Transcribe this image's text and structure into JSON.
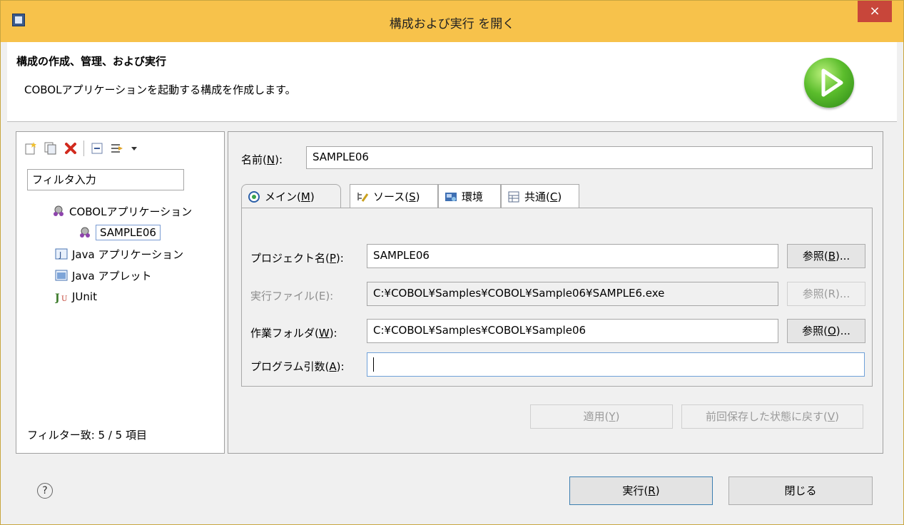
{
  "window": {
    "title": "構成および実行 を開く",
    "close_glyph": "×"
  },
  "header": {
    "title": "構成の作成、管理、および実行",
    "description": "COBOLアプリケーションを起動する構成を作成します。"
  },
  "left": {
    "filter_placeholder": "フィルタ入力",
    "tree": [
      {
        "label": "COBOLアプリケーション",
        "icon": "cobol-app-icon"
      },
      {
        "label": "SAMPLE06",
        "icon": "cobol-config-icon"
      },
      {
        "label": "Java アプリケーション",
        "icon": "java-app-icon"
      },
      {
        "label": "Java アプレット",
        "icon": "java-applet-icon"
      },
      {
        "label": "JUnit",
        "icon": "junit-icon"
      }
    ],
    "filter_count": "フィルター致: 5 / 5 項目"
  },
  "right": {
    "name_label": "名前(",
    "name_key": "N",
    "name_label_end": "):",
    "name_value": "SAMPLE06",
    "tabs": [
      {
        "label": "メイン(",
        "key": "M",
        "end": ")"
      },
      {
        "label": "ソース(",
        "key": "S",
        "end": ")"
      },
      {
        "label": "環境",
        "key": "",
        "end": ""
      },
      {
        "label": "共通(",
        "key": "C",
        "end": ")"
      }
    ],
    "rows": {
      "project": {
        "label": "プロジェクト名(",
        "key": "P",
        "end": "):",
        "value": "SAMPLE06",
        "browse": "参照(",
        "browse_key": "B",
        "browse_end": ")..."
      },
      "exe": {
        "label": "実行ファイル(E):",
        "value": "C:¥COBOL¥Samples¥COBOL¥Sample06¥SAMPLE6.exe",
        "browse": "参照(R)..."
      },
      "workdir": {
        "label": "作業フォルダ(",
        "key": "W",
        "end": "):",
        "value": "C:¥COBOL¥Samples¥COBOL¥Sample06",
        "browse": "参照(",
        "browse_key": "O",
        "browse_end": ")..."
      },
      "args": {
        "label": "プログラム引数(",
        "key": "A",
        "end": "):",
        "value": ""
      }
    },
    "apply": {
      "label": "適用(",
      "key": "Y",
      "end": ")"
    },
    "revert": {
      "label": "前回保存した状態に戻す(",
      "key": "V",
      "end": ")"
    }
  },
  "footer": {
    "help_glyph": "?",
    "run": {
      "label": "実行(",
      "key": "R",
      "end": ")"
    },
    "close": "閉じる"
  },
  "colors": {
    "titlebar": "#f7c24b",
    "close": "#c8463a",
    "run_icon": "#5bbd2c"
  }
}
